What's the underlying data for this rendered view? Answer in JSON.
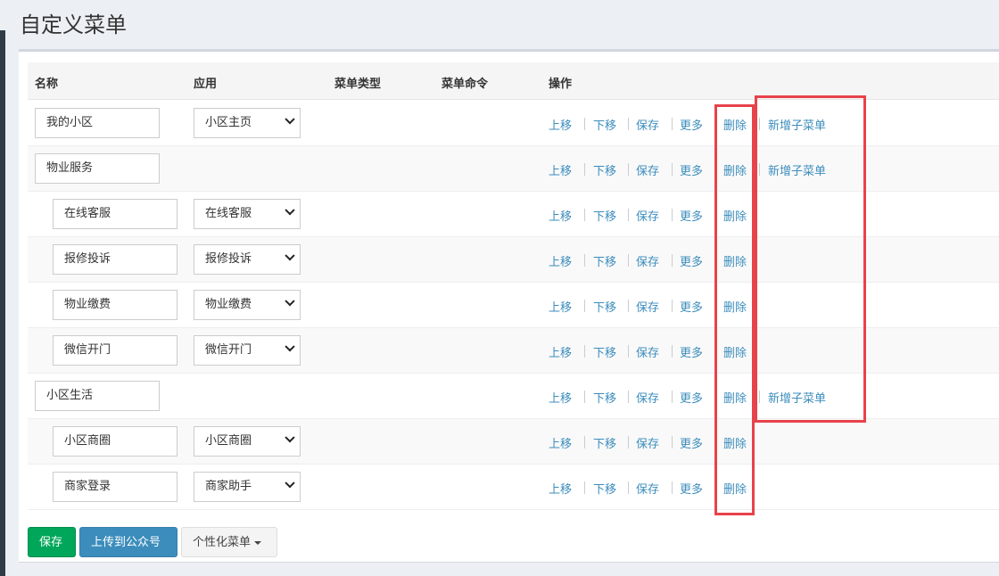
{
  "page": {
    "title": "自定义菜单"
  },
  "table": {
    "headers": {
      "name": "名称",
      "app": "应用",
      "type": "菜单类型",
      "command": "菜单命令",
      "ops": "操作"
    }
  },
  "ops_labels": {
    "up": "上移",
    "down": "下移",
    "save": "保存",
    "more": "更多",
    "delete": "删除",
    "add_sub": "新增子菜单"
  },
  "rows": [
    {
      "name": "我的小区",
      "app": "小区主页"
    },
    {
      "name": "物业服务"
    },
    {
      "name": "在线客服",
      "app": "在线客服"
    },
    {
      "name": "报修投诉",
      "app": "报修投诉"
    },
    {
      "name": "物业缴费",
      "app": "物业缴费"
    },
    {
      "name": "微信开门",
      "app": "微信开门"
    },
    {
      "name": "小区生活"
    },
    {
      "name": "小区商圈",
      "app": "小区商圈"
    },
    {
      "name": "商家登录",
      "app": "商家助手"
    }
  ],
  "footer": {
    "save": "保存",
    "upload": "上传到公众号",
    "personalize": "个性化菜单"
  },
  "colors": {
    "link": "#3c8dbc",
    "save_btn": "#00a65a",
    "upload_btn": "#3c8dbc",
    "highlight": "#e8424a"
  }
}
